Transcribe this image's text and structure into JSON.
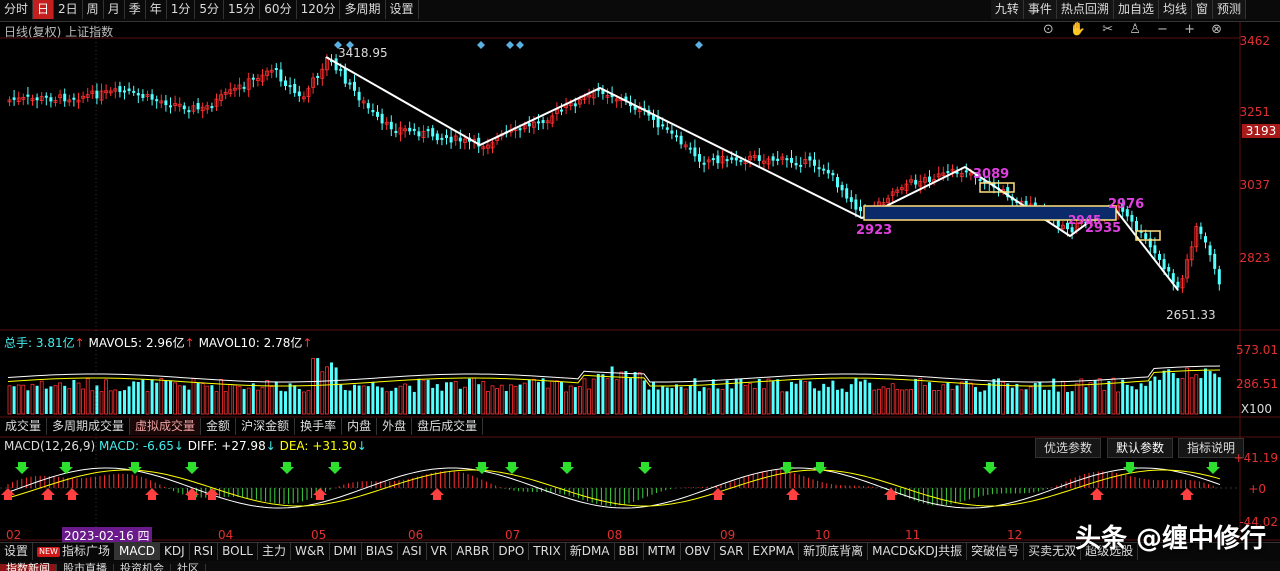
{
  "toolbar": {
    "left": [
      "分时",
      "日",
      "2日",
      "周",
      "月",
      "季",
      "年",
      "1分",
      "5分",
      "15分",
      "60分",
      "120分",
      "多周期",
      "设置"
    ],
    "active": "日",
    "right": [
      "九转",
      "事件",
      "热点回溯",
      "加自选",
      "均线",
      "窗",
      "预测"
    ]
  },
  "chart_title": "日线(复权) 上证指数",
  "price_axis": {
    "labels": [
      "3462",
      "3251",
      "3037",
      "2823"
    ],
    "current": "3193"
  },
  "annotations": {
    "high": "3418.95",
    "low": "2651.33",
    "p2923": "2923",
    "p3089": "3089",
    "p2976": "2976",
    "p2935": "2935",
    "p2945": "2945"
  },
  "volume": {
    "label_total": "总手:",
    "total": "3.81亿",
    "mavol5_label": "MAVOL5:",
    "mavol5": "2.96亿",
    "mavol10_label": "MAVOL10:",
    "mavol10": "2.78亿",
    "axis": [
      "573.01",
      "286.51",
      "X100"
    ]
  },
  "volume_tabs": [
    "成交量",
    "多周期成交量",
    "虚拟成交量",
    "金额",
    "沪深金额",
    "换手率",
    "内盘",
    "外盘",
    "盘后成交量"
  ],
  "volume_active": "虚拟成交量",
  "macd": {
    "title": "MACD(12,26,9)",
    "macd_label": "MACD:",
    "macd_value": "-6.65",
    "diff_label": "DIFF:",
    "diff_value": "+27.98",
    "dea_label": "DEA:",
    "dea_value": "+31.30",
    "axis": [
      "+41.19",
      "+0",
      "-44.02"
    ],
    "buttons": [
      "优选参数",
      "默认参数",
      "指标说明"
    ]
  },
  "dates": {
    "d02": "02",
    "highlight": "2023-02-16 四",
    "d04": "04",
    "d05": "05",
    "d06": "06",
    "d07": "07",
    "d08": "08",
    "d09": "09",
    "d10": "10",
    "d11": "11",
    "d12": "12"
  },
  "indicator_tabs": [
    "设置",
    "指标广场",
    "MACD",
    "KDJ",
    "RSI",
    "BOLL",
    "主力",
    "W&R",
    "DMI",
    "BIAS",
    "ASI",
    "VR",
    "ARBR",
    "DPO",
    "TRIX",
    "新DMA",
    "BBI",
    "MTM",
    "OBV",
    "SAR",
    "EXPMA",
    "新顶底背离",
    "MACD&KDJ共振",
    "突破信号",
    "买卖无双",
    "超级选股"
  ],
  "indicator_active": "MACD",
  "bottom_tabs": [
    "指数新闻",
    "股市直播",
    "投资机会",
    "社区"
  ],
  "watermark": "头条 @缠中修行",
  "colors": {
    "up": "#ff3030",
    "down": "#54ffff",
    "axis": "#e03030"
  }
}
